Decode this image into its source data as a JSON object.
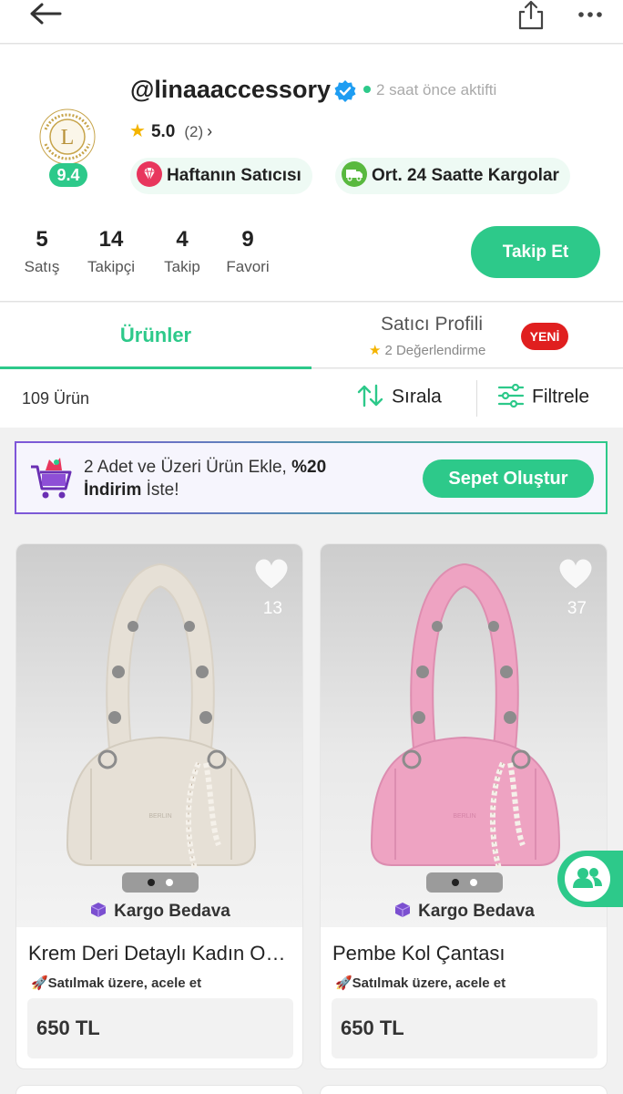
{
  "topbar": {
    "back_icon": "arrow-left-icon",
    "share_icon": "share-icon",
    "more_icon": "more-horizontal-icon"
  },
  "profile": {
    "username": "@linaaaccessory",
    "active_status": "2 saat önce aktifti",
    "rating_value": "5.0",
    "rating_count": "(2)",
    "seller_score": "9.4",
    "badges": [
      {
        "label": "Haftanın Satıcısı",
        "icon": "diamond-icon",
        "color": "#e8365d"
      },
      {
        "label": "Ort. 24 Saatte Kargolar",
        "icon": "truck-icon",
        "color": "#59b93f"
      }
    ],
    "stats": [
      {
        "value": "5",
        "label": "Satış"
      },
      {
        "value": "14",
        "label": "Takipçi"
      },
      {
        "value": "4",
        "label": "Takip"
      },
      {
        "value": "9",
        "label": "Favori"
      }
    ],
    "follow_label": "Takip Et"
  },
  "tabs": {
    "products": "Ürünler",
    "seller_profile": "Satıcı Profili",
    "seller_reviews": "2 Değerlendirme",
    "new_badge": "YENİ"
  },
  "toolbar": {
    "count": "109 Ürün",
    "sort": "Sırala",
    "filter": "Filtrele"
  },
  "promo": {
    "text_plain": "2 Adet ve Üzeri Ürün Ekle, ",
    "text_bold_1": "%20",
    "text_bold_2": "İndirim",
    "text_tail": " İste!",
    "button": "Sepet Oluştur"
  },
  "products": [
    {
      "title": "Krem Deri Detaylı Kadın Omuz Çantası",
      "fav_count": "13",
      "shipping": "Kargo Bedava",
      "urgency": "🚀Satılmak üzere, acele et",
      "price": "650 TL",
      "bag_color": "#e6e0d6"
    },
    {
      "title": "Pembe Kol Çantası",
      "fav_count": "37",
      "shipping": "Kargo Bedava",
      "urgency": "🚀Satılmak üzere, acele et",
      "price": "650 TL",
      "bag_color": "#eea3c2"
    }
  ],
  "colors": {
    "accent": "#2dc98a",
    "new_badge": "#e01f1f",
    "star": "#f4b400"
  }
}
